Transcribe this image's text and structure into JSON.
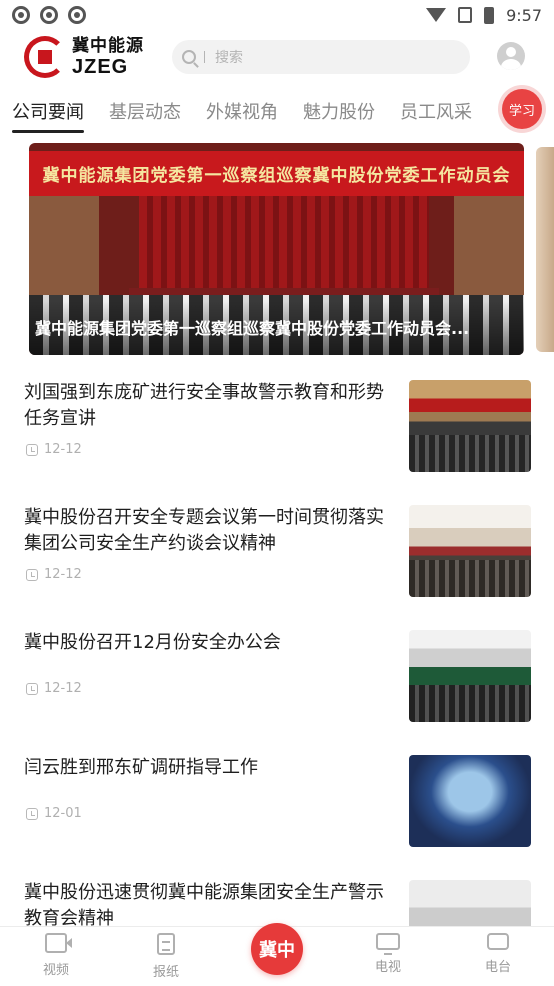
{
  "status_bar": {
    "time": "9:57"
  },
  "header": {
    "logo_cn": "冀中能源",
    "logo_en": "JZEG",
    "search_placeholder": "搜索"
  },
  "tabs": [
    {
      "label": "公司要闻",
      "active": true
    },
    {
      "label": "基层动态",
      "active": false
    },
    {
      "label": "外媒视角",
      "active": false
    },
    {
      "label": "魅力股份",
      "active": false
    },
    {
      "label": "员工风采",
      "active": false
    }
  ],
  "study_button": "学习",
  "banner": {
    "sign_text": "冀中能源集团党委第一巡察组巡察冀中股份党委工作动员会",
    "caption": "冀中能源集团党委第一巡察组巡察冀中股份党委工作动员会..."
  },
  "news": [
    {
      "title": "刘国强到东庞矿进行安全事故警示教育和形势任务宣讲",
      "date": "12-12"
    },
    {
      "title": "冀中股份召开安全专题会议第一时间贯彻落实集团公司安全生产约谈会议精神",
      "date": "12-12"
    },
    {
      "title": "冀中股份召开12月份安全办公会",
      "date": "12-12"
    },
    {
      "title": "闫云胜到邢东矿调研指导工作",
      "date": "12-01"
    },
    {
      "title": "冀中股份迅速贯彻冀中能源集团安全生产警示教育会精神",
      "date": ""
    }
  ],
  "bottom_nav": {
    "video": "视频",
    "newspaper": "报纸",
    "center": "冀中",
    "tv": "电视",
    "radio": "电台"
  },
  "colors": {
    "accent": "#e63a3a",
    "brand_red": "#c8161d"
  }
}
